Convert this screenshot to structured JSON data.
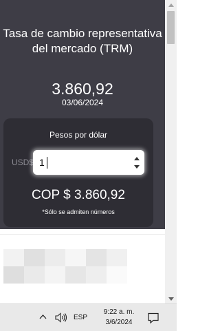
{
  "header": {
    "title": "Tasa de cambio representativa del mercado (TRM)",
    "rate": "3.860,92",
    "date": "03/06/2024"
  },
  "converter": {
    "label": "Pesos por dólar",
    "input_prefix": "USD$",
    "input_value": "1",
    "result": "COP $ 3.860,92",
    "note": "*Sólo se admiten números"
  },
  "mosaic_colors": [
    "#f2f2f2",
    "#e0e0e0",
    "#ececec",
    "#f6f6f6",
    "#e4e4e4",
    "#f0f0f0",
    "#dedede",
    "#eaeaea",
    "#f4f4f4",
    "#e6e6e6",
    "#eeeeee",
    "#fafafa"
  ],
  "taskbar": {
    "language": "ESP",
    "time": "9:22 a. m.",
    "date": "3/6/2024"
  },
  "colors": {
    "panel": "#3e3d46",
    "card": "#2e2d34"
  }
}
